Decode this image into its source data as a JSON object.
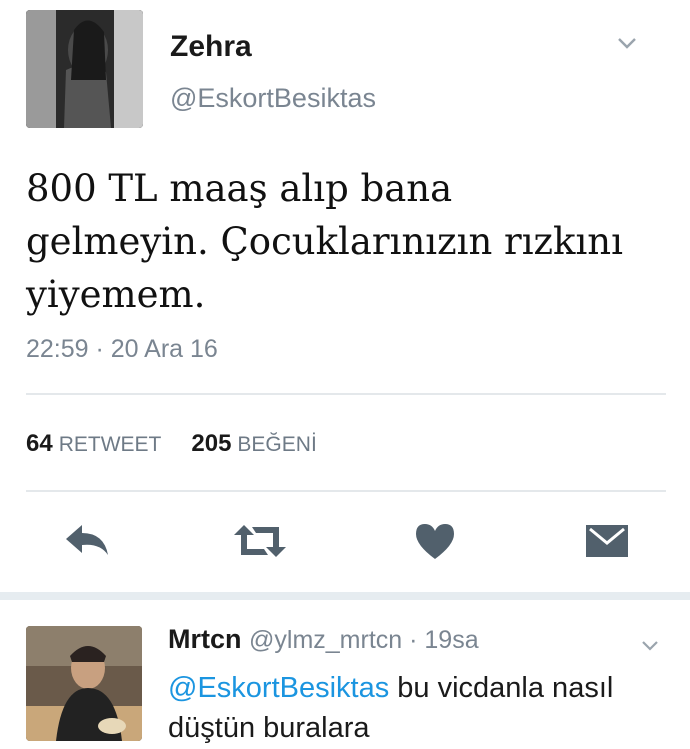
{
  "tweet": {
    "name": "Zehra",
    "handle": "@EskortBesiktas",
    "text": "800 TL maaş alıp bana gelmeyin. Çocuklarınızın rızkını yiyemem.",
    "timestamp": "22:59 · 20 Ara 16",
    "retweet_count": "64",
    "retweet_label": "RETWEET",
    "like_count": "205",
    "like_label": "BEĞENİ",
    "actions": [
      "reply-icon",
      "retweet-icon",
      "heart-icon",
      "dm-envelope-icon"
    ]
  },
  "reply": {
    "name": "Mrtcn",
    "handle": "@ylmz_mrtcn",
    "meta": " · 19sa",
    "mention": "@EskortBesiktas",
    "text": " bu vicdanla nasıl düştün buralara"
  },
  "colors": {
    "link": "#1b95e0",
    "muted": "#7a8591",
    "action_icon": "#51606c"
  }
}
